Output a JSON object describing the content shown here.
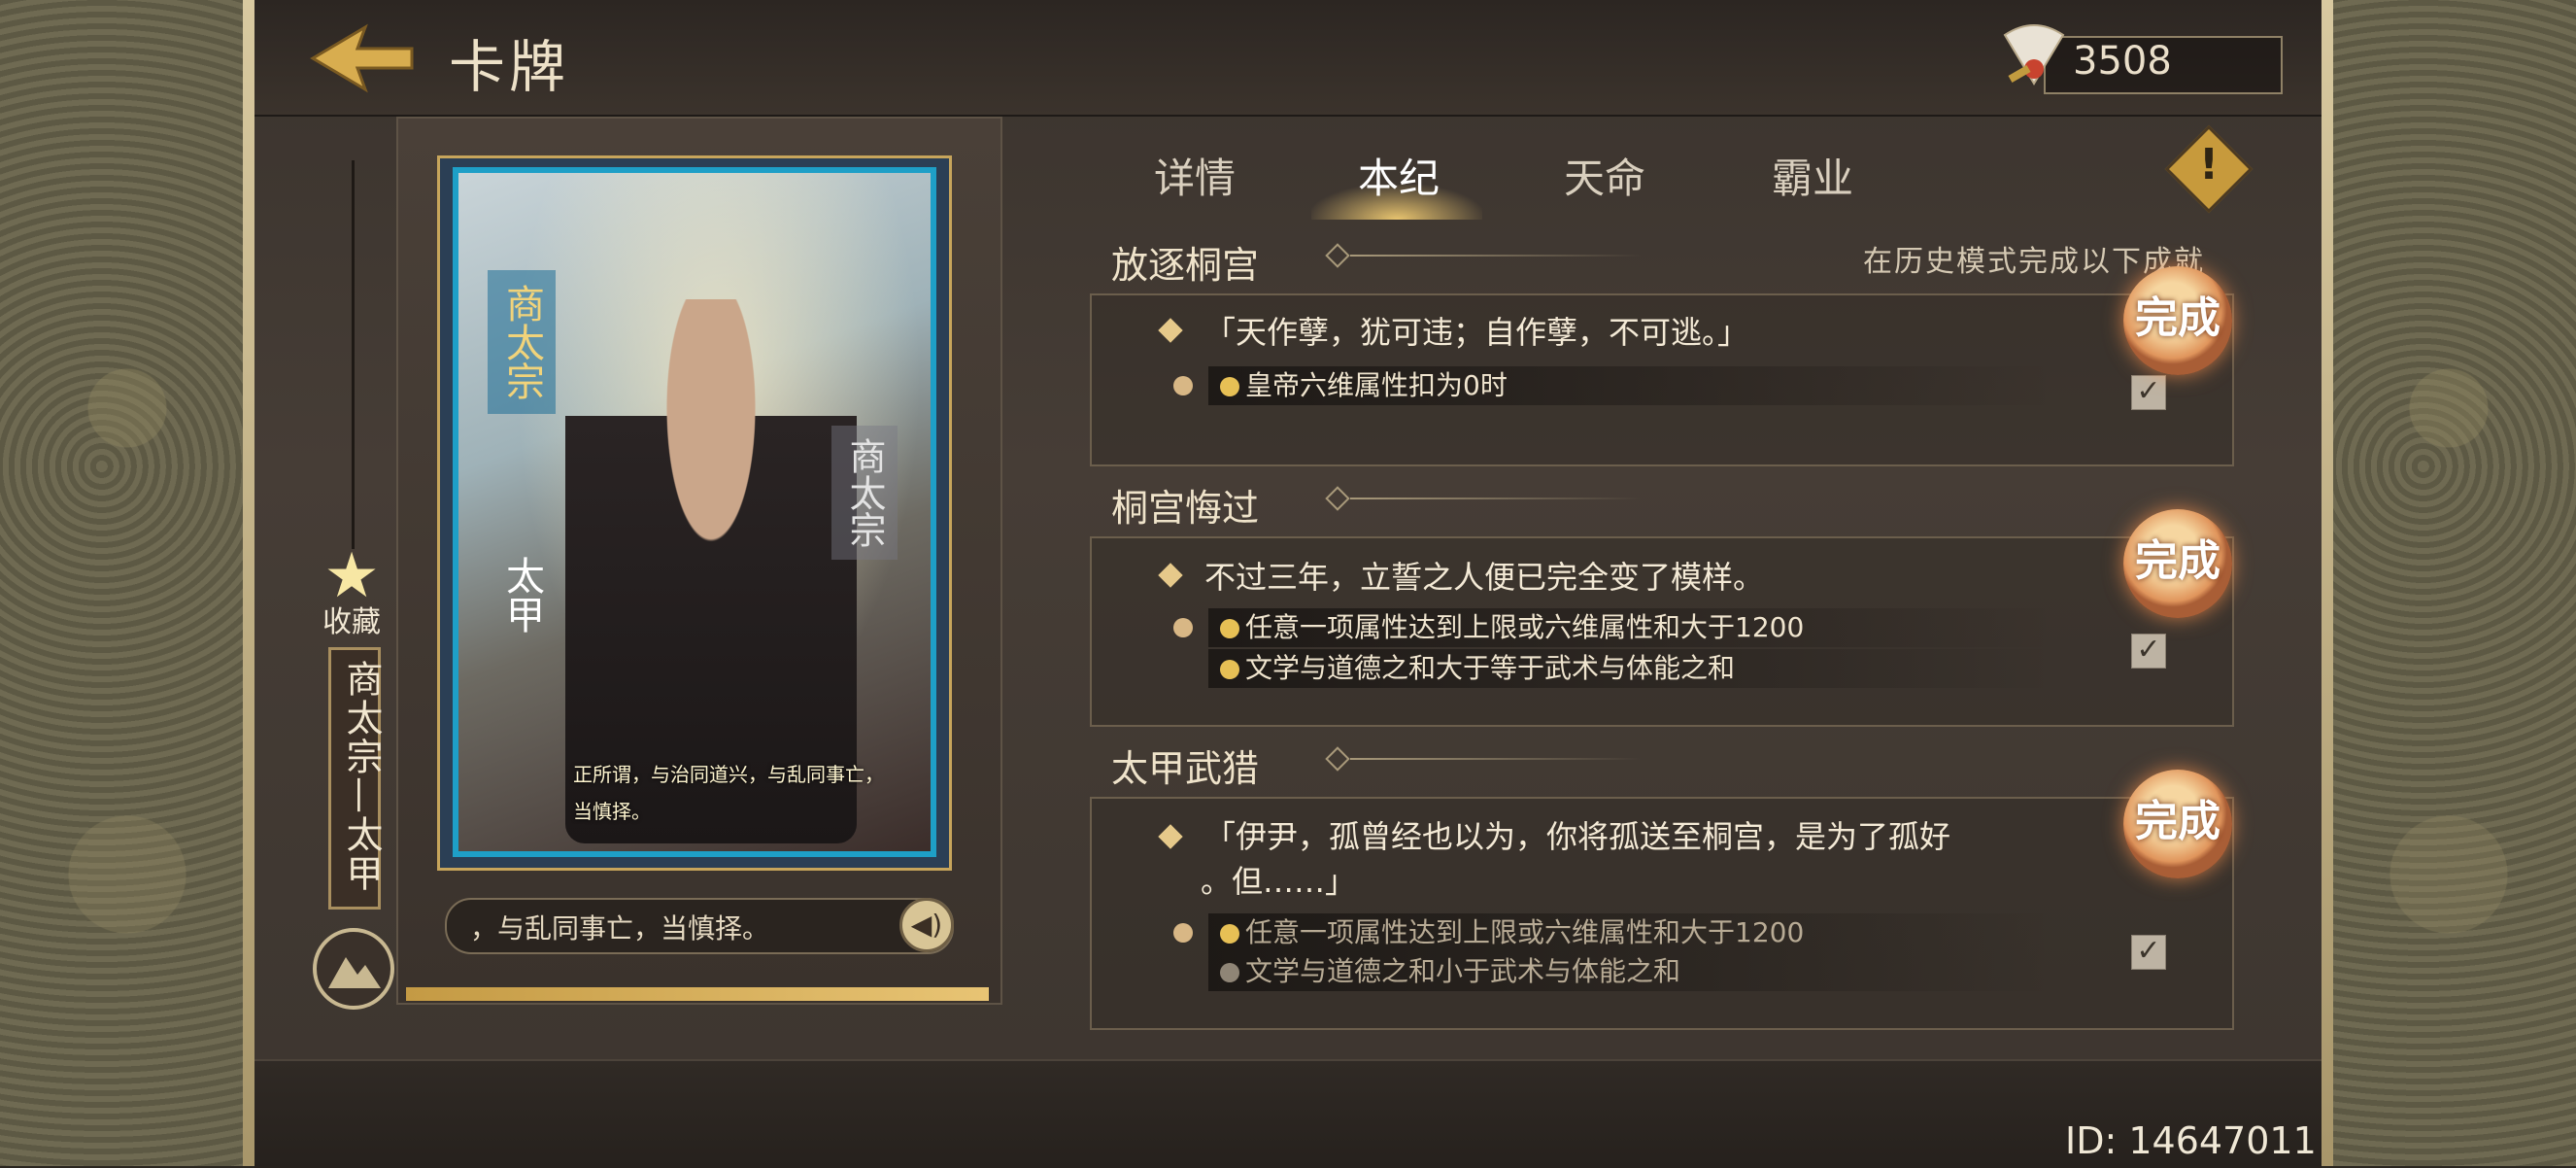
{
  "header": {
    "title": "卡牌",
    "currency_value": "3508"
  },
  "tabs": [
    {
      "label": "详情",
      "active": false
    },
    {
      "label": "本纪",
      "active": true
    },
    {
      "label": "天命",
      "active": false
    },
    {
      "label": "霸业",
      "active": false
    }
  ],
  "card": {
    "vertical_name": "商太宗",
    "vertical_name_lower": "太甲",
    "vertical_name_right": "商太宗",
    "quote": "正所谓，与治同道兴，与乱同事亡，当慎择。",
    "favorite_label": "收藏",
    "name_plate": "商太宗—太甲",
    "dialogue": "，与乱同事亡，当慎择。",
    "progress": 1.0
  },
  "hint": "在历史模式完成以下成就",
  "achievements": [
    {
      "title": "放逐桐宫",
      "quote": [
        "「天作孽，犹可违；自作孽，不可逃。」"
      ],
      "conditions": [
        {
          "text": "皇帝六维属性扣为0时",
          "met": true
        }
      ],
      "badge": "完成",
      "checked": true
    },
    {
      "title": "桐宫悔过",
      "quote": [
        "不过三年，立誓之人便已完全变了模样。"
      ],
      "conditions": [
        {
          "text": "任意一项属性达到上限或六维属性和大于1200",
          "met": true
        },
        {
          "text": "文学与道德之和大于等于武术与体能之和",
          "met": true
        }
      ],
      "badge": "完成",
      "checked": true
    },
    {
      "title": "太甲武猎",
      "quote": [
        "「伊尹，孤曾经也以为，你将孤送至桐宫，是为了孤好",
        "。但……」"
      ],
      "conditions": [
        {
          "text": "任意一项属性达到上限或六维属性和大于1200",
          "met": true
        },
        {
          "text": "文学与道德之和小于武术与体能之和",
          "met": false
        }
      ],
      "badge": "完成",
      "checked": true
    }
  ],
  "footer": {
    "user_id": "ID: 14647011"
  },
  "colors": {
    "accent": "#c79a3c",
    "badge": "#e0955c",
    "tab_active": "#ffffff"
  },
  "icons": [
    "back-arrow-icon",
    "fan-feather-icon",
    "alert-icon",
    "star-icon",
    "mountain-icon",
    "speaker-icon",
    "check-icon"
  ]
}
